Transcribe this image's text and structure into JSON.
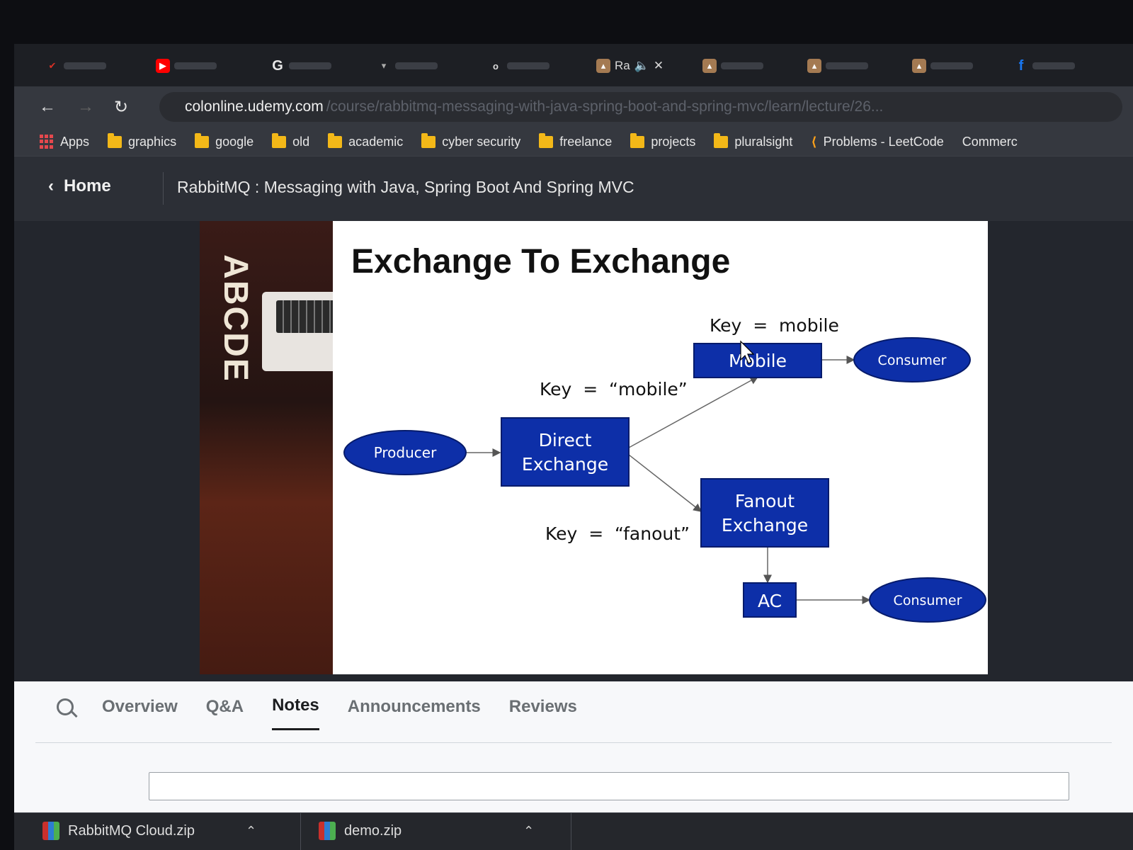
{
  "browser": {
    "tabs": [
      {
        "icon": "gmail-icon",
        "color": "#d93025"
      },
      {
        "icon": "youtube-icon",
        "color": "#ff0000"
      },
      {
        "icon": "google-icon",
        "color": "#e8e8e8"
      },
      {
        "icon": "tab-icon",
        "color": "#888888"
      },
      {
        "icon": "tab-icon",
        "color": "#888888"
      },
      {
        "icon": "udemy-icon",
        "color": "#a47a52",
        "label": "Ra",
        "active": true
      },
      {
        "icon": "udemy-icon",
        "color": "#a47a52"
      },
      {
        "icon": "udemy-icon",
        "color": "#a47a52"
      },
      {
        "icon": "udemy-icon",
        "color": "#a47a52"
      },
      {
        "icon": "facebook-icon",
        "color": "#1877f2"
      }
    ],
    "active_tab_label": "Ra",
    "url_host": "colonline.udemy.com",
    "url_path": "/course/rabbitmq-messaging-with-java-spring-boot-and-spring-mvc/learn/lecture/26...",
    "bookmarks": {
      "apps": "Apps",
      "folders": [
        "graphics",
        "google",
        "old",
        "academic",
        "cyber security",
        "freelance",
        "projects",
        "pluralsight"
      ],
      "leetcode": "Problems - LeetCode",
      "more": "Commerc"
    }
  },
  "course": {
    "home_label": "Home",
    "title": "RabbitMQ : Messaging with Java, Spring Boot And Spring MVC"
  },
  "webcam": {
    "sign_text": "ABCDE"
  },
  "slide": {
    "title": "Exchange To Exchange",
    "producer": "Producer",
    "direct_exchange": [
      "Direct",
      "Exchange"
    ],
    "fanout_exchange": [
      "Fanout",
      "Exchange"
    ],
    "mobile_queue": "Mobile",
    "ac_queue": "AC",
    "consumer_top": "Consumer",
    "consumer_bottom": "Consumer",
    "key_mobile_top": "Key  =  mobile",
    "key_mobile_quoted": "Key  =  “mobile”",
    "key_fanout_quoted": "Key  =  “fanout”",
    "colors": {
      "node_fill": "#0d2fa8",
      "node_stroke": "#061b6b"
    }
  },
  "panel": {
    "tabs": [
      "Overview",
      "Q&A",
      "Notes",
      "Announcements",
      "Reviews"
    ],
    "active_tab": "Notes"
  },
  "downloads": [
    {
      "name": "RabbitMQ Cloud.zip"
    },
    {
      "name": "demo.zip"
    }
  ]
}
